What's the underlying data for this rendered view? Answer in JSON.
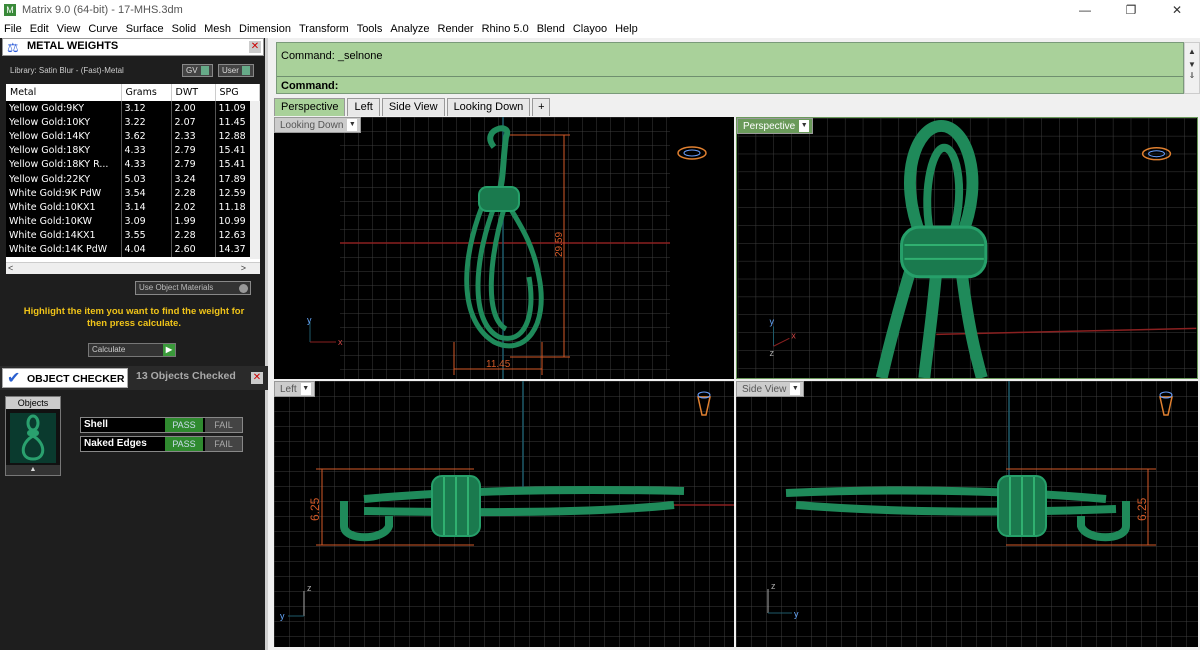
{
  "window": {
    "title": "Matrix 9.0 (64-bit) - 17-MHS.3dm",
    "minimize": "—",
    "restore": "❐",
    "close": "✕"
  },
  "menu": [
    "File",
    "Edit",
    "View",
    "Curve",
    "Surface",
    "Solid",
    "Mesh",
    "Dimension",
    "Transform",
    "Tools",
    "Analyze",
    "Render",
    "Rhino 5.0",
    "Blend",
    "Clayoo",
    "Help"
  ],
  "metal_weights": {
    "title": "METAL WEIGHTS",
    "library": "Library: Satin Blur - (Fast)-Metal",
    "gv_label": "GV",
    "user_label": "User",
    "columns": [
      "Metal",
      "Grams",
      "DWT",
      "SPG"
    ],
    "rows": [
      [
        "Yellow Gold:9KY",
        "3.12",
        "2.00",
        "11.09"
      ],
      [
        "Yellow Gold:10KY",
        "3.22",
        "2.07",
        "11.45"
      ],
      [
        "Yellow Gold:14KY",
        "3.62",
        "2.33",
        "12.88"
      ],
      [
        "Yellow Gold:18KY",
        "4.33",
        "2.79",
        "15.41"
      ],
      [
        "Yellow Gold:18KY R...",
        "4.33",
        "2.79",
        "15.41"
      ],
      [
        "Yellow Gold:22KY",
        "5.03",
        "3.24",
        "17.89"
      ],
      [
        "White Gold:9K PdW",
        "3.54",
        "2.28",
        "12.59"
      ],
      [
        "White Gold:10KX1",
        "3.14",
        "2.02",
        "11.18"
      ],
      [
        "White Gold:10KW",
        "3.09",
        "1.99",
        "10.99"
      ],
      [
        "White Gold:14KX1",
        "3.55",
        "2.28",
        "12.63"
      ],
      [
        "White Gold:14K PdW",
        "4.04",
        "2.60",
        "14.37"
      ]
    ],
    "use_object_materials": "Use Object Materials",
    "hint": "Highlight the item you want to find the weight for then press calculate.",
    "calculate": "Calculate"
  },
  "object_checker": {
    "title": "OBJECT CHECKER",
    "count": "13 Objects Checked",
    "objects_label": "Objects",
    "checks": [
      {
        "name": "Shell",
        "pass": "PASS",
        "fail": "FAIL"
      },
      {
        "name": "Naked Edges",
        "pass": "PASS",
        "fail": "FAIL"
      }
    ]
  },
  "command": {
    "history": "Command: _selnone",
    "prompt": "Command:"
  },
  "viewport_tabs": [
    "Perspective",
    "Left",
    "Side View",
    "Looking Down",
    "+"
  ],
  "viewports": {
    "top_left": {
      "name": "Looking Down",
      "dim_height": "29.59",
      "dim_width": "11.45"
    },
    "top_right": {
      "name": "Perspective"
    },
    "bottom_left": {
      "name": "Left",
      "dim": "6.25"
    },
    "bottom_right": {
      "name": "Side View",
      "dim": "6.25"
    }
  },
  "axes": {
    "x": "x",
    "y": "y",
    "z": "z"
  },
  "colors": {
    "model_green": "#1f8a5a",
    "grid": "#4a4a4a",
    "command_bg": "#a9d19a",
    "hint": "#f0c419",
    "dimension": "#e0602a"
  }
}
